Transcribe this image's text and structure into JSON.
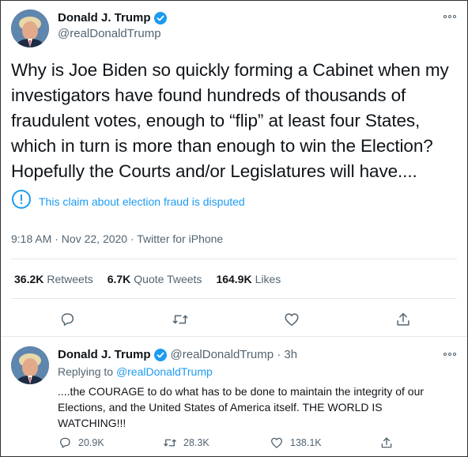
{
  "main_tweet": {
    "author_name": "Donald J. Trump",
    "handle": "@realDonaldTrump",
    "text": "Why is Joe Biden so quickly forming a Cabinet when my investigators have found hundreds of thousands of fraudulent votes, enough to “flip” at least four States, which in turn is more than enough to win the Election? Hopefully the Courts and/or Legislatures will have....",
    "disputed_label": "This claim about election fraud is disputed",
    "meta": "9:18 AM · Nov 22, 2020 · Twitter for iPhone",
    "stats": {
      "retweets_count": "36.2K",
      "retweets_label": "Retweets",
      "quotes_count": "6.7K",
      "quotes_label": "Quote Tweets",
      "likes_count": "164.9K",
      "likes_label": "Likes"
    }
  },
  "reply_tweet": {
    "author_name": "Donald J. Trump",
    "handle_time": "@realDonaldTrump · 3h",
    "replying_prefix": "Replying to",
    "replying_mention": "@realDonaldTrump",
    "text": "....the COURAGE to do what has to be done to maintain the integrity of our Elections,  and the United States of America itself. THE WORLD IS WATCHING!!!",
    "reply_count": "20.9K",
    "retweet_count": "28.3K",
    "like_count": "138.1K"
  },
  "icons": [
    "verified-badge-icon",
    "more-icon",
    "alert-circle-icon",
    "reply-icon",
    "retweet-icon",
    "like-icon",
    "share-icon"
  ],
  "colors": {
    "accent": "#1d9bf0",
    "secondary_text": "#536471",
    "border": "#2f3336"
  }
}
